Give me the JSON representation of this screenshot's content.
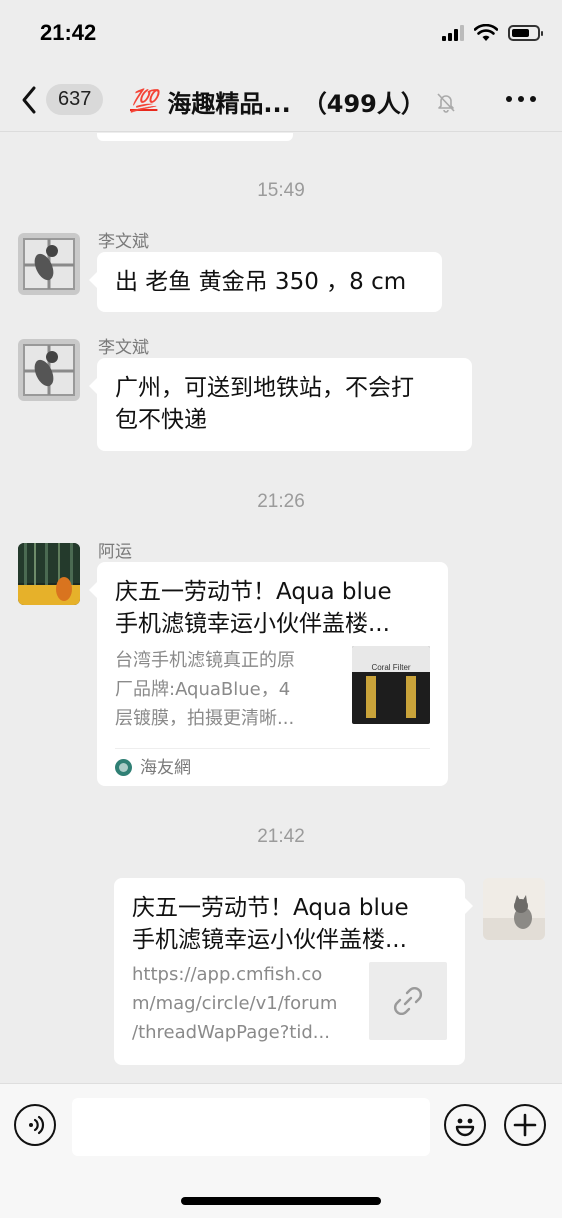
{
  "status_bar": {
    "time": "21:42"
  },
  "nav": {
    "back_count": "637",
    "emoji": "💯",
    "title": "海趣精品...",
    "member_count": "（499人）"
  },
  "messages": [
    {
      "type": "time",
      "text": "15:49"
    },
    {
      "type": "text",
      "sender": "李文斌",
      "text": "出 老鱼 黄金吊 350 ，8 cm"
    },
    {
      "type": "text",
      "sender": "李文斌",
      "text_line1": "广州，可送到地铁站，不会打",
      "text_line2": "包不快递"
    },
    {
      "type": "time",
      "text": "21:26"
    },
    {
      "type": "card",
      "sender": "阿运",
      "title_line1": "庆五一劳动节！Aqua blue",
      "title_line2": "手机滤镜幸运小伙伴盖楼...",
      "desc_line1": "台湾手机滤镜真正的原",
      "desc_line2": "厂品牌:AquaBlue，4",
      "desc_line3": "层镀膜，拍摄更清晰...",
      "thumb_label": "Coral Filter",
      "source": "海友網"
    },
    {
      "type": "time",
      "text": "21:42"
    },
    {
      "type": "link-card",
      "sender": "me",
      "title_line1": "庆五一劳动节！Aqua blue",
      "title_line2": "手机滤镜幸运小伙伴盖楼...",
      "url_line1": "https://app.cmfish.co",
      "url_line2": "m/mag/circle/v1/forum",
      "url_line3": "/threadWapPage?tid..."
    }
  ],
  "colors": {
    "background": "#ededed",
    "bubble": "#ffffff",
    "timestamp": "#9b9b9b",
    "emoji_red": "#e8281b"
  },
  "icons": [
    "back-chevron-icon",
    "mute-bell-icon",
    "more-icon",
    "voice-icon",
    "emoji-icon",
    "plus-icon",
    "link-icon"
  ]
}
